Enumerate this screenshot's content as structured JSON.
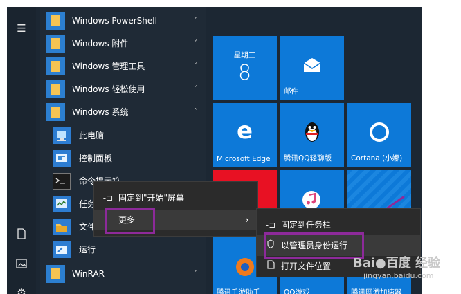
{
  "start_list": {
    "items": [
      {
        "label": "Windows PowerShell",
        "chevron": "˅"
      },
      {
        "label": "Windows 附件",
        "chevron": "˅"
      },
      {
        "label": "Windows 管理工具",
        "chevron": "˅"
      },
      {
        "label": "Windows 轻松使用",
        "chevron": "˅"
      },
      {
        "label": "Windows 系统",
        "chevron": "˄"
      }
    ],
    "sub_items": [
      {
        "label": "此电脑"
      },
      {
        "label": "控制面板"
      },
      {
        "label": "命令提示符"
      },
      {
        "label": "任务管理器"
      },
      {
        "label": "文件资源管理器"
      },
      {
        "label": "运行"
      }
    ],
    "bottom_item": {
      "label": "WinRAR",
      "chevron": "˅"
    }
  },
  "tiles": {
    "calendar": {
      "weekday": "星期三",
      "day": "8"
    },
    "mail": {
      "label": "邮件"
    },
    "edge": {
      "label": "Microsoft Edge"
    },
    "qq": {
      "label": "腾讯QQ轻聊版"
    },
    "cortana": {
      "label": "Cortana (小娜)"
    },
    "bottom": [
      {
        "label": "腾讯手游助手"
      },
      {
        "label": "QQ游戏"
      },
      {
        "label": "腾讯网游加速器"
      }
    ]
  },
  "context_menu": {
    "pin_start": "固定到\"开始\"屏幕",
    "more": "更多",
    "more_arrow": "›"
  },
  "more_menu": {
    "pin_taskbar": "固定到任务栏",
    "run_as_admin": "以管理员身份运行",
    "open_location": "打开文件位置"
  },
  "watermark": {
    "brand": "Bai●百度 经验",
    "url": "jingyan.baidu.com"
  },
  "colors": {
    "tile_blue": "#0d79d8",
    "highlight": "#8d2a9a",
    "menu_bg": "#2b2b2b"
  }
}
